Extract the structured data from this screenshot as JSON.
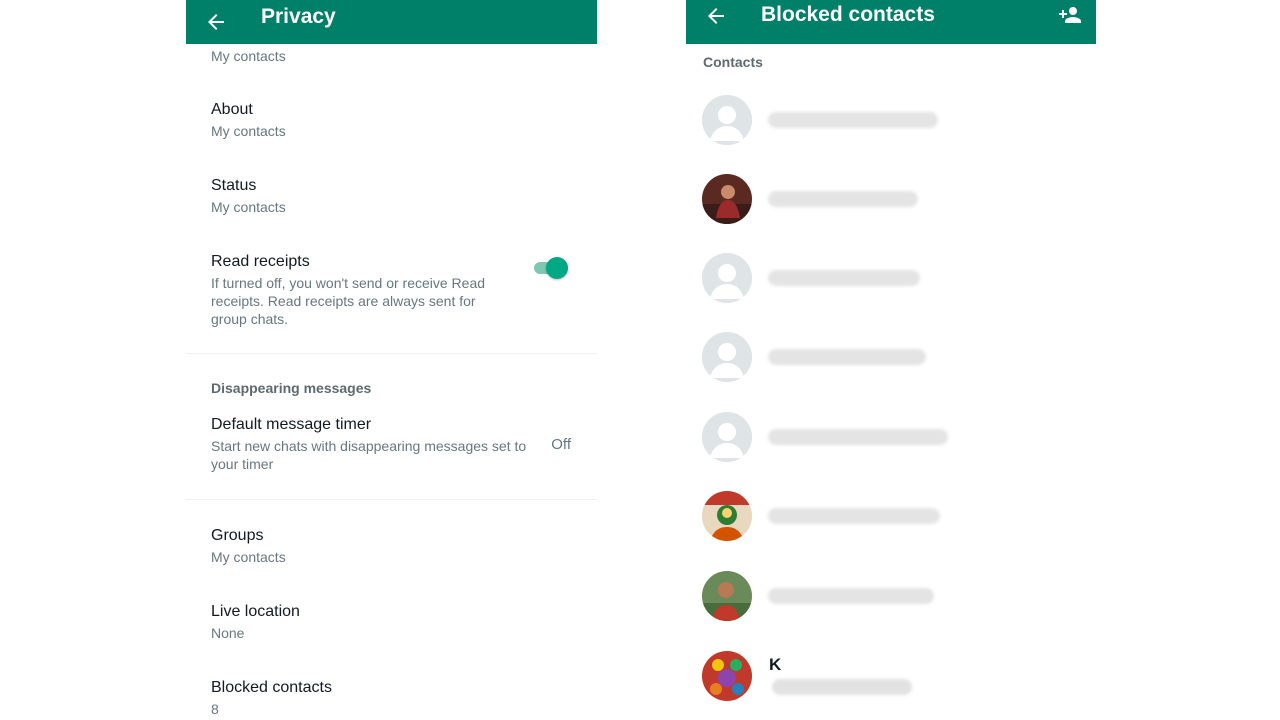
{
  "left": {
    "title": "Privacy",
    "top_partial_sub": "My contacts",
    "rows": [
      {
        "title": "About",
        "sub": "My contacts"
      },
      {
        "title": "Status",
        "sub": "My contacts"
      }
    ],
    "read_receipts": {
      "title": "Read receipts",
      "sub": "If turned off, you won't send or receive Read receipts. Read receipts are always sent for group chats.",
      "enabled": true
    },
    "disappearing_section": "Disappearing messages",
    "default_timer": {
      "title": "Default message timer",
      "sub": "Start new chats with disappearing messages set to your timer",
      "value": "Off"
    },
    "bottom_rows": [
      {
        "title": "Groups",
        "sub": "My contacts"
      },
      {
        "title": "Live location",
        "sub": "None"
      },
      {
        "title": "Blocked contacts",
        "sub": "8"
      }
    ]
  },
  "right": {
    "title": "Blocked contacts",
    "section": "Contacts",
    "last_contact_initial": "K"
  },
  "colors": {
    "appbar": "#008069",
    "accent": "#00a884",
    "secondary_text": "#667781"
  },
  "icons": {
    "back": "arrow-left-icon",
    "add_contact": "person-add-icon",
    "default_avatar": "person-placeholder-icon"
  }
}
